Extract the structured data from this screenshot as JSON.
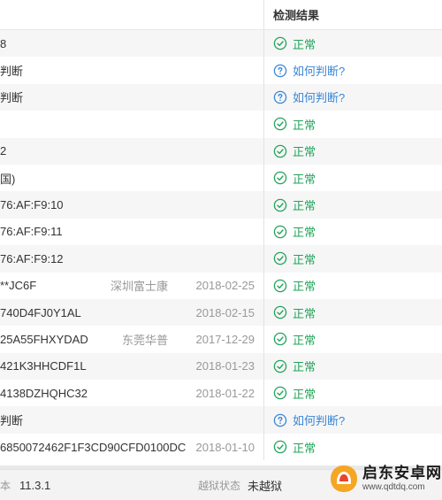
{
  "header": {
    "result_col": "检测结果"
  },
  "rows": [
    {
      "value": "8",
      "vendor": "",
      "date": "",
      "result": "正常",
      "kind": "ok"
    },
    {
      "value": "判断",
      "vendor": "",
      "date": "",
      "result": "如何判断?",
      "kind": "help"
    },
    {
      "value": "判断",
      "vendor": "",
      "date": "",
      "result": "如何判断?",
      "kind": "help"
    },
    {
      "value": "",
      "vendor": "",
      "date": "",
      "result": "正常",
      "kind": "ok"
    },
    {
      "value": "2",
      "vendor": "",
      "date": "",
      "result": "正常",
      "kind": "ok"
    },
    {
      "value": "国)",
      "vendor": "",
      "date": "",
      "result": "正常",
      "kind": "ok"
    },
    {
      "value": "76:AF:F9:10",
      "vendor": "",
      "date": "",
      "result": "正常",
      "kind": "ok"
    },
    {
      "value": "76:AF:F9:11",
      "vendor": "",
      "date": "",
      "result": "正常",
      "kind": "ok"
    },
    {
      "value": "76:AF:F9:12",
      "vendor": "",
      "date": "",
      "result": "正常",
      "kind": "ok"
    },
    {
      "value": "**JC6F",
      "vendor": "深圳富士康",
      "date": "2018-02-25",
      "result": "正常",
      "kind": "ok"
    },
    {
      "value": "740D4FJ0Y1AL",
      "vendor": "",
      "date": "2018-02-15",
      "result": "正常",
      "kind": "ok"
    },
    {
      "value": "25A55FHXYDAD",
      "vendor": "东莞华普",
      "date": "2017-12-29",
      "result": "正常",
      "kind": "ok"
    },
    {
      "value": "421K3HHCDF1L",
      "vendor": "",
      "date": "2018-01-23",
      "result": "正常",
      "kind": "ok"
    },
    {
      "value": "4138DZHQHC32",
      "vendor": "",
      "date": "2018-01-22",
      "result": "正常",
      "kind": "ok"
    },
    {
      "value": "判断",
      "vendor": "",
      "date": "",
      "result": "如何判断?",
      "kind": "help"
    },
    {
      "value": "6850072462F1F3CD90CFD0100DC",
      "vendor": "",
      "date": "2018-01-10",
      "result": "正常",
      "kind": "ok"
    }
  ],
  "footer": {
    "version_label": "本",
    "version_value": "11.3.1",
    "jailbreak_label": "越狱状态",
    "jailbreak_value": "未越狱"
  },
  "watermark": {
    "name": "启东安卓网",
    "url": "www.qdtdq.com"
  },
  "colors": {
    "ok": "#22a35a",
    "help": "#3a86d6"
  },
  "icons": {
    "ok": "check-circle-icon",
    "help": "question-circle-icon"
  }
}
